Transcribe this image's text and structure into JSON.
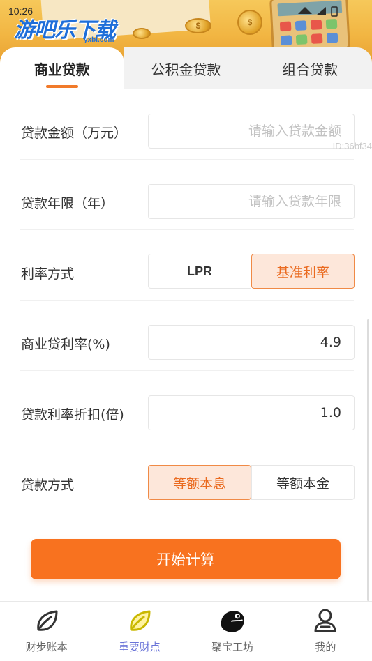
{
  "status_bar": {
    "time": "10:26"
  },
  "banner": {
    "logo_text": "游吧乐下载",
    "logo_sub": "yxbl.com",
    "coin_symbol": "$"
  },
  "tabs": [
    {
      "label": "商业贷款",
      "active": true
    },
    {
      "label": "公积金贷款",
      "active": false
    },
    {
      "label": "组合贷款",
      "active": false
    }
  ],
  "form": {
    "loan_amount": {
      "label": "贷款金额（万元）",
      "value": "",
      "placeholder": "请输入贷款金额"
    },
    "loan_years": {
      "label": "贷款年限（年）",
      "value": "",
      "placeholder": "请输入贷款年限"
    },
    "rate_mode": {
      "label": "利率方式",
      "options": [
        "LPR",
        "基准利率"
      ],
      "selected": "基准利率"
    },
    "commercial_rate": {
      "label": "商业贷利率(%)",
      "value": "4.9"
    },
    "rate_discount": {
      "label": "贷款利率折扣(倍)",
      "value": "1.0"
    },
    "repay_mode": {
      "label": "贷款方式",
      "options": [
        "等额本息",
        "等额本金"
      ],
      "selected": "等额本息"
    }
  },
  "watermark_id": "ID:36bf34",
  "calculate_button": "开始计算",
  "bottom_nav": [
    {
      "label": "财步账本",
      "icon": "leaf-outline-icon",
      "active": false
    },
    {
      "label": "重要财点",
      "icon": "leaf-yellow-icon",
      "active": true
    },
    {
      "label": "聚宝工坊",
      "icon": "pelican-icon",
      "active": false
    },
    {
      "label": "我的",
      "icon": "user-icon",
      "active": false
    }
  ],
  "colors": {
    "accent": "#f8721f",
    "accent_light": "#fde7da",
    "nav_active": "#6a74d8",
    "tab_underline": "#f17a2a"
  }
}
